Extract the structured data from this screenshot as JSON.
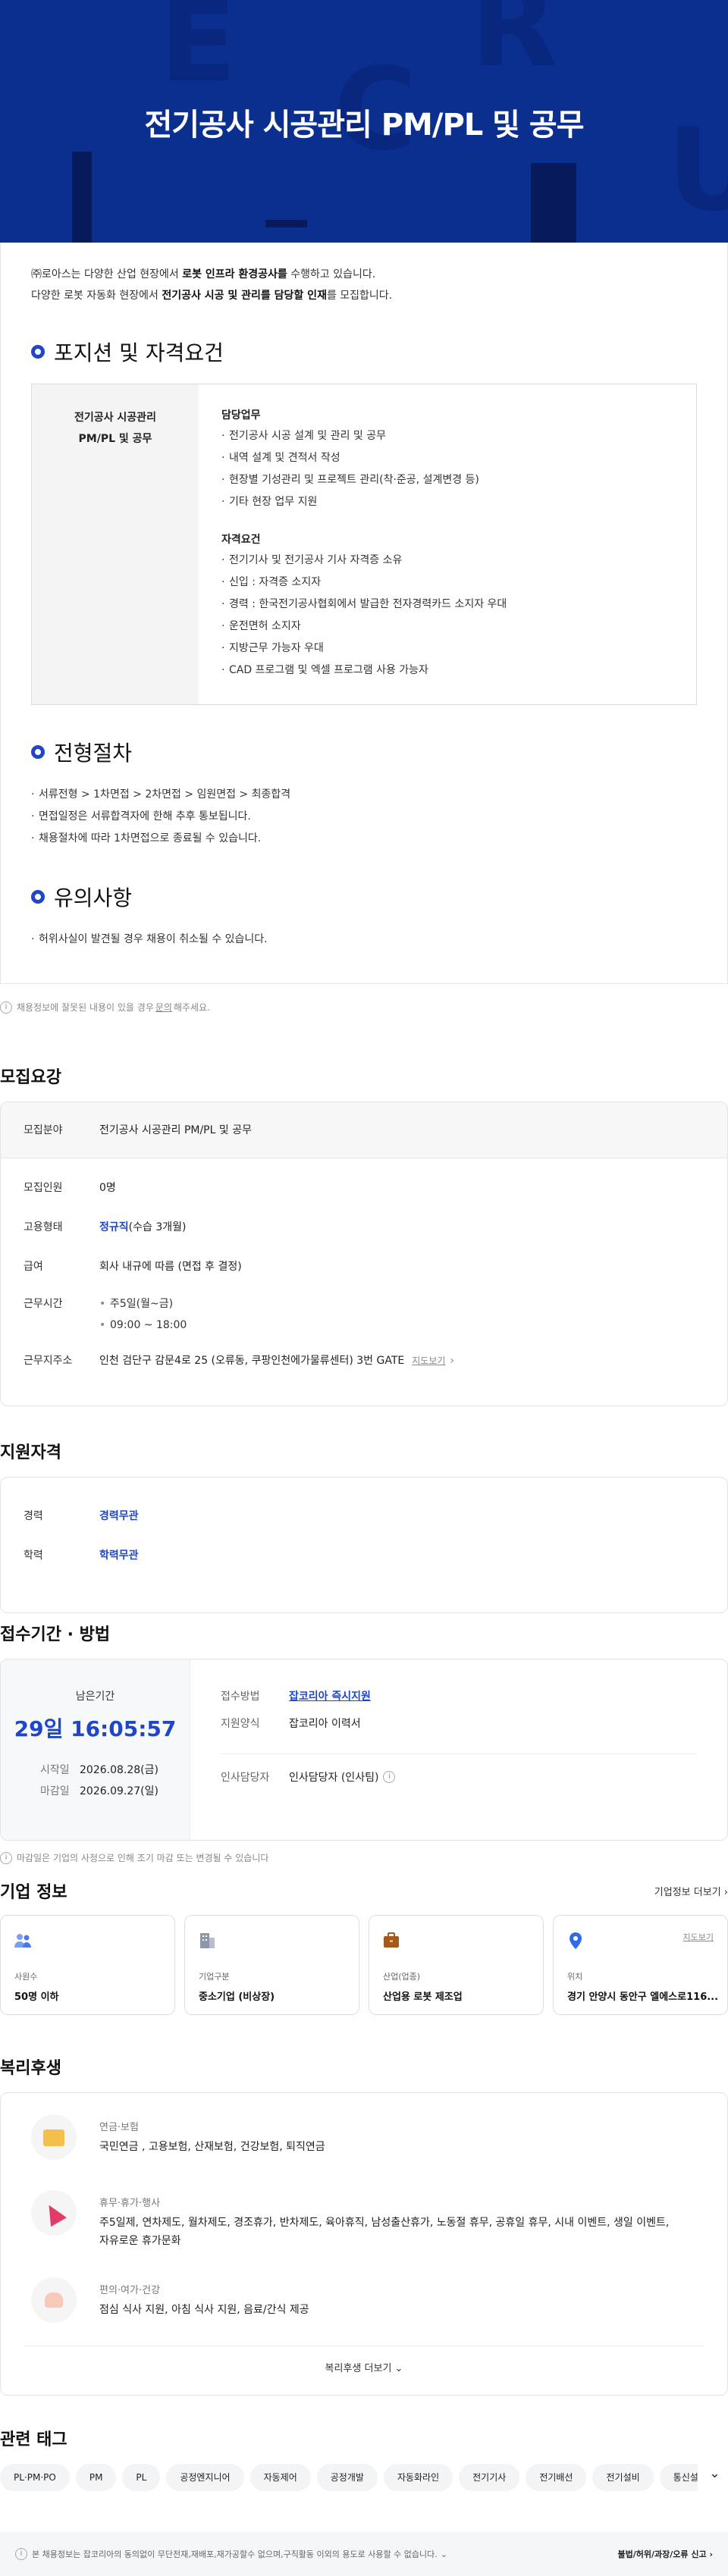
{
  "hero": {
    "title": "전기공사 시공관리 PM/PL 및 공무",
    "letters": [
      "E",
      "R",
      "C",
      "U",
      "I",
      "E"
    ]
  },
  "intro": {
    "line1_pre": "㈜로아스는 다양한 산업 현장에서 ",
    "line1_bold": "로봇 인프라 환경공사를",
    "line1_post": " 수행하고 있습니다.",
    "line2_pre": "다양한 로봇 자동화 현장에서 ",
    "line2_bold": "전기공사 시공 및 관리를 담당할 인재",
    "line2_post": "를 모집합니다."
  },
  "position": {
    "section_title": "포지션 및 자격요건",
    "job_line1": "전기공사 시공관리",
    "job_line2": "PM/PL 및 공무",
    "duties_title": "담당업무",
    "duties": [
      "전기공사 시공 설계 및 관리 및 공무",
      "내역 설계 및 견적서 작성",
      "현장별 기성관리 및 프로젝트 관리(착·준공, 설계변경 등)",
      "기타 현장 업무 지원"
    ],
    "quals_title": "자격요건",
    "quals": [
      "전기기사 및 전기공사 기사 자격증 소유",
      "신입 : 자격증 소지자",
      "경력 : 한국전기공사협회에서 발급한 전자경력카드 소지자 우대",
      "운전면허 소지자",
      "지방근무 가능자 우대",
      "CAD 프로그램 및 엑셀 프로그램 사용 가능자"
    ]
  },
  "process": {
    "section_title": "전형절차",
    "items": [
      "서류전형 > 1차면접 > 2차면접 > 임원면접 > 최종합격",
      "면접일정은 서류합격자에 한해 추후 통보됩니다.",
      "채용절차에 따라 1차면접으로 종료될 수 있습니다."
    ]
  },
  "notice": {
    "section_title": "유의사항",
    "items": [
      "허위사실이 발견될 경우 채용이 취소될 수 있습니다."
    ]
  },
  "report_note": {
    "pre": "채용정보에 잘못된 내용이 있을 경우 ",
    "link": "문의",
    "post": "해주세요."
  },
  "recruit": {
    "title": "모집요강",
    "field_label": "모집분야",
    "field_value": "전기공사 시공관리 PM/PL 및 공무",
    "people_label": "모집인원",
    "people_value": "0명",
    "type_label": "고용형태",
    "type_value_blue": "정규직",
    "type_value_rest": "(수습 3개월)",
    "pay_label": "급여",
    "pay_value": "회사 내규에 따름 (면접 후 결정)",
    "hours_label": "근무시간",
    "hours": [
      "주5일(월~금)",
      "09:00 ~ 18:00"
    ],
    "addr_label": "근무지주소",
    "addr_value": "인천 검단구 감문4로 25 (오류동, 쿠팡인천에가물류센터) 3번 GATE",
    "map_link": "지도보기"
  },
  "qualification": {
    "title": "지원자격",
    "career_label": "경력",
    "career_value": "경력무관",
    "edu_label": "학력",
    "edu_value": "학력무관"
  },
  "apply": {
    "title": "접수기간 · 방법",
    "remaining_label": "남은기간",
    "remaining_value": "29일 16:05:57",
    "start_label": "시작일",
    "start_value": "2026.08.28(금)",
    "end_label": "마감일",
    "end_value": "2026.09.27(일)",
    "method_label": "접수방법",
    "method_value": "잡코리아 즉시지원",
    "form_label": "지원양식",
    "form_value": "잡코리아 이력서",
    "manager_label": "인사담당자",
    "manager_value": "인사담당자 (인사팀)",
    "note": "마감일은 기업의 사정으로 인해 조기 마감 또는 변경될 수 있습니다"
  },
  "company": {
    "title": "기업 정보",
    "more": "기업정보 더보기",
    "cards": [
      {
        "label": "사원수",
        "value": "50명 이하",
        "icon": "people-icon"
      },
      {
        "label": "기업구분",
        "value": "중소기업 (비상장)",
        "icon": "building-icon"
      },
      {
        "label": "산업(업종)",
        "value": "산업용 로봇 제조업",
        "icon": "briefcase-icon"
      },
      {
        "label": "위치",
        "value": "경기 안양시 동안구 엘에스로116...",
        "icon": "location-icon",
        "link": "지도보기"
      }
    ]
  },
  "benefits": {
    "title": "복리후생",
    "items": [
      {
        "category": "연금·보험",
        "text": "국민연금 , 고용보험, 산재보험, 건강보험, 퇴직연금"
      },
      {
        "category": "휴무·휴가·행사",
        "text": "주5일제, 연차제도, 월차제도, 경조휴가, 반차제도, 육아휴직, 남성출산휴가, 노동절 휴무, 공휴일 휴무, 시내 이벤트, 생일 이벤트, 자유로운 휴가문화"
      },
      {
        "category": "편의·여가·건강",
        "text": "점심 식사 지원, 아침 식사 지원, 음료/간식 제공"
      }
    ],
    "more": "복리후생 더보기"
  },
  "tags": {
    "title": "관련 태그",
    "items": [
      "PL·PM·PO",
      "PM",
      "PL",
      "공정엔지니어",
      "자동제어",
      "공정개발",
      "자동화라인",
      "전기기사",
      "전기배선",
      "전기설비",
      "통신설비"
    ]
  },
  "footer": {
    "text": "본 채용정보는 잡코리아의 동의없이 무단전재,재배포,재가공할수 없으며,구직활동 이외의 용도로 사용할 수 없습니다.",
    "report": "불법/허위/과장/오류 신고"
  },
  "colors": {
    "brand_blue": "#1d46c9",
    "hero_bg": "#0b2f8f"
  }
}
